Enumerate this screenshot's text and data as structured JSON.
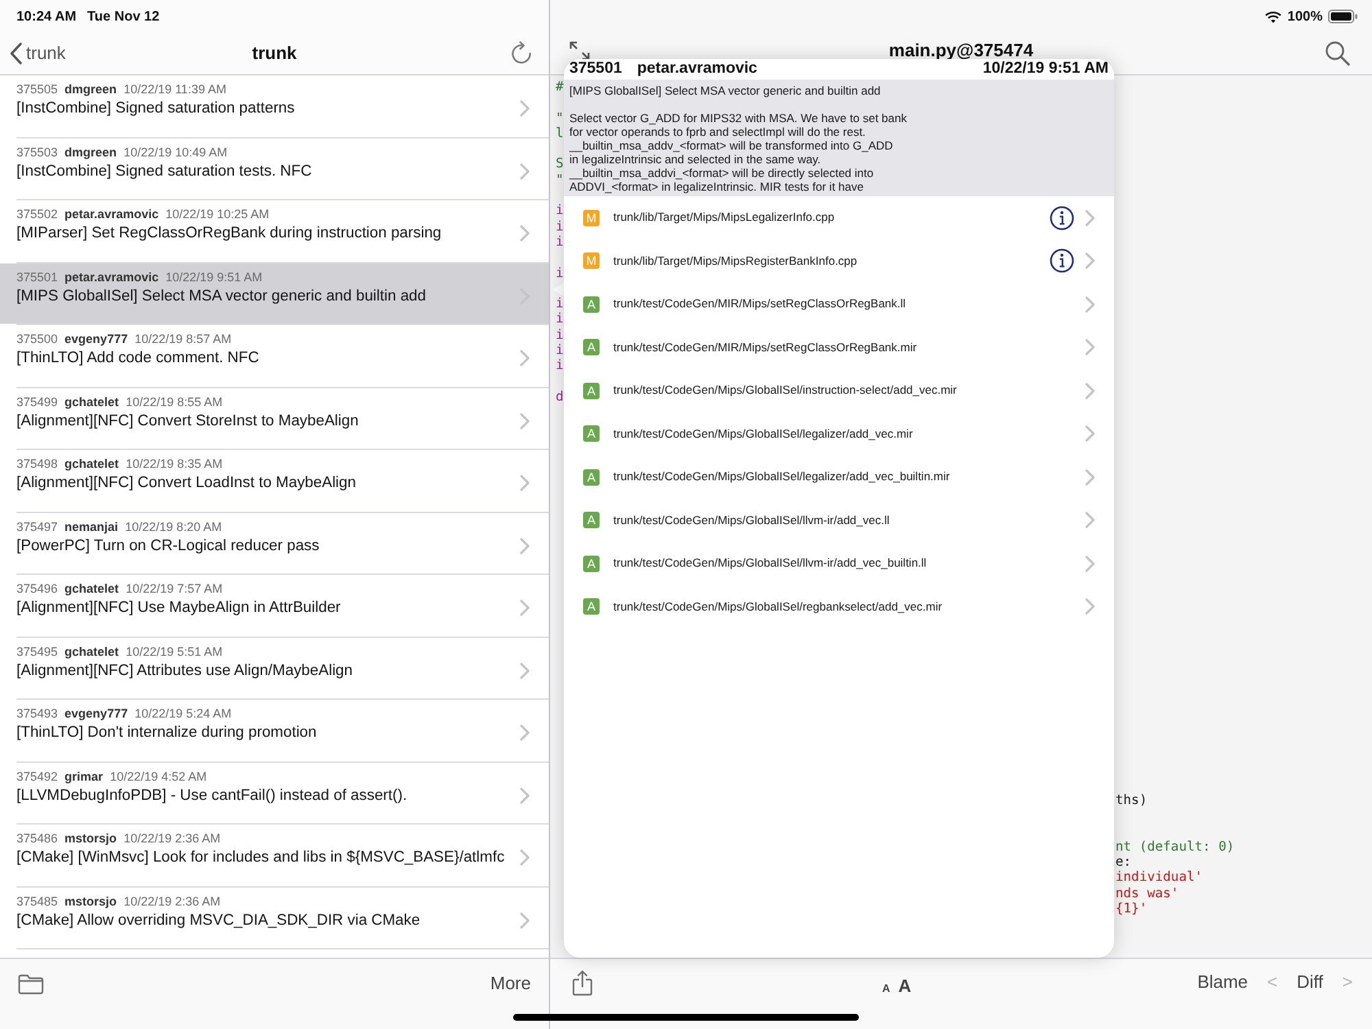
{
  "status_bar": {
    "time": "10:24 AM",
    "date": "Tue Nov 12",
    "battery": "100%"
  },
  "commit_list": {
    "back": "trunk",
    "title": "trunk",
    "commits": [
      {
        "id": "375505",
        "author": "dmgreen",
        "date": "10/22/19 11:39 AM",
        "title": "[InstCombine] Signed saturation patterns",
        "selected": false
      },
      {
        "id": "375503",
        "author": "dmgreen",
        "date": "10/22/19 10:49 AM",
        "title": "[InstCombine] Signed saturation tests. NFC",
        "selected": false
      },
      {
        "id": "375502",
        "author": "petar.avramovic",
        "date": "10/22/19 10:25 AM",
        "title": "[MIParser] Set RegClassOrRegBank during instruction parsing",
        "selected": false
      },
      {
        "id": "375501",
        "author": "petar.avramovic",
        "date": "10/22/19 9:51 AM",
        "title": "[MIPS GlobalISel] Select MSA vector generic and builtin add",
        "selected": true
      },
      {
        "id": "375500",
        "author": "evgeny777",
        "date": "10/22/19 8:57 AM",
        "title": "[ThinLTO] Add code comment. NFC",
        "selected": false
      },
      {
        "id": "375499",
        "author": "gchatelet",
        "date": "10/22/19 8:55 AM",
        "title": "[Alignment][NFC] Convert StoreInst to MaybeAlign",
        "selected": false
      },
      {
        "id": "375498",
        "author": "gchatelet",
        "date": "10/22/19 8:35 AM",
        "title": "[Alignment][NFC] Convert LoadInst to MaybeAlign",
        "selected": false
      },
      {
        "id": "375497",
        "author": "nemanjai",
        "date": "10/22/19 8:20 AM",
        "title": "[PowerPC] Turn on CR-Logical reducer pass",
        "selected": false
      },
      {
        "id": "375496",
        "author": "gchatelet",
        "date": "10/22/19 7:57 AM",
        "title": "[Alignment][NFC] Use MaybeAlign in AttrBuilder",
        "selected": false
      },
      {
        "id": "375495",
        "author": "gchatelet",
        "date": "10/22/19 5:51 AM",
        "title": "[Alignment][NFC] Attributes use Align/MaybeAlign",
        "selected": false
      },
      {
        "id": "375493",
        "author": "evgeny777",
        "date": "10/22/19 5:24 AM",
        "title": "[ThinLTO] Don't internalize during promotion",
        "selected": false
      },
      {
        "id": "375492",
        "author": "grimar",
        "date": "10/22/19 4:52 AM",
        "title": "[LLVMDebugInfoPDB] - Use cantFail() instead of assert().",
        "selected": false
      },
      {
        "id": "375486",
        "author": "mstorsjo",
        "date": "10/22/19 2:36 AM",
        "title": "[CMake] [WinMsvc] Look for includes and libs in ${MSVC_BASE}/atlmfc",
        "selected": false
      },
      {
        "id": "375485",
        "author": "mstorsjo",
        "date": "10/22/19 2:36 AM",
        "title": "[CMake] Allow overriding MSVC_DIA_SDK_DIR via CMake",
        "selected": false
      }
    ]
  },
  "left_toolbar": {
    "more": "More"
  },
  "editor": {
    "title": "main.py@375474",
    "code_left_edge": [
      [
        {
          "text": "#",
          "kind": "comment"
        }
      ],
      [
        {
          "text": "\"",
          "kind": "comment"
        },
        {
          "text": "l",
          "kind": "comment"
        }
      ],
      [
        {
          "text": "S",
          "kind": "comment"
        },
        {
          "text": "\"",
          "kind": "comment"
        }
      ],
      [
        {
          "text": "i",
          "kind": "keyword"
        },
        {
          "text": "i",
          "kind": "keyword"
        },
        {
          "text": "i",
          "kind": "keyword"
        }
      ],
      [
        {
          "text": "i",
          "kind": "keyword"
        }
      ],
      [
        {
          "text": "i",
          "kind": "keyword"
        },
        {
          "text": "i",
          "kind": "keyword"
        },
        {
          "text": "i",
          "kind": "keyword"
        },
        {
          "text": "i",
          "kind": "keyword"
        },
        {
          "text": "i",
          "kind": "keyword"
        }
      ],
      [
        {
          "text": "d",
          "kind": "keyword"
        }
      ]
    ],
    "code_right_edge": [
      [
        {
          "text": "ths)",
          "kind": "plain"
        }
      ],
      [
        {
          "text": "nt (default: 0)",
          "kind": "comment"
        },
        {
          "text": "e:",
          "kind": "plain"
        },
        {
          "text": "individual'",
          "kind": "string"
        },
        {
          "text": "nds was'",
          "kind": "string"
        },
        {
          "text": "{1}'",
          "kind": "string"
        }
      ]
    ]
  },
  "popover": {
    "id": "375501",
    "author": "petar.avramovic",
    "date": "10/22/19 9:51 AM",
    "subject": "[MIPS GlobalISel] Select MSA vector generic and builtin add",
    "body_lines": [
      "Select vector G_ADD for MIPS32 with MSA. We have to set bank",
      "for vector operands to fprb and selectImpl will do the rest.",
      "__builtin_msa_addv_<format> will be transformed into G_ADD",
      "in legalizeIntrinsic and selected in the same way.",
      "__builtin_msa_addvi_<format> will be directly selected into",
      "ADDVI_<format> in legalizeIntrinsic. MIR tests for it have"
    ],
    "files": [
      {
        "status": "M",
        "kind": "modified",
        "path": "trunk/lib/Target/Mips/MipsLegalizerInfo.cpp",
        "info": true
      },
      {
        "status": "M",
        "kind": "modified",
        "path": "trunk/lib/Target/Mips/MipsRegisterBankInfo.cpp",
        "info": true
      },
      {
        "status": "A",
        "kind": "added",
        "path": "trunk/test/CodeGen/MIR/Mips/setRegClassOrRegBank.ll",
        "info": false
      },
      {
        "status": "A",
        "kind": "added",
        "path": "trunk/test/CodeGen/MIR/Mips/setRegClassOrRegBank.mir",
        "info": false
      },
      {
        "status": "A",
        "kind": "added",
        "path": "trunk/test/CodeGen/Mips/GlobalISel/instruction-select/add_vec.mir",
        "info": false
      },
      {
        "status": "A",
        "kind": "added",
        "path": "trunk/test/CodeGen/Mips/GlobalISel/legalizer/add_vec.mir",
        "info": false
      },
      {
        "status": "A",
        "kind": "added",
        "path": "trunk/test/CodeGen/Mips/GlobalISel/legalizer/add_vec_builtin.mir",
        "info": false
      },
      {
        "status": "A",
        "kind": "added",
        "path": "trunk/test/CodeGen/Mips/GlobalISel/llvm-ir/add_vec.ll",
        "info": false
      },
      {
        "status": "A",
        "kind": "added",
        "path": "trunk/test/CodeGen/Mips/GlobalISel/llvm-ir/add_vec_builtin.ll",
        "info": false
      },
      {
        "status": "A",
        "kind": "added",
        "path": "trunk/test/CodeGen/Mips/GlobalISel/regbankselect/add_vec.mir",
        "info": false
      }
    ]
  },
  "editor_toolbar": {
    "font_smaller": "A",
    "font_larger": "A",
    "actions": [
      {
        "label": "Blame",
        "disabled": false
      },
      {
        "label": "<",
        "disabled": true
      },
      {
        "label": "Diff",
        "disabled": false
      },
      {
        "label": ">",
        "disabled": true
      }
    ]
  }
}
